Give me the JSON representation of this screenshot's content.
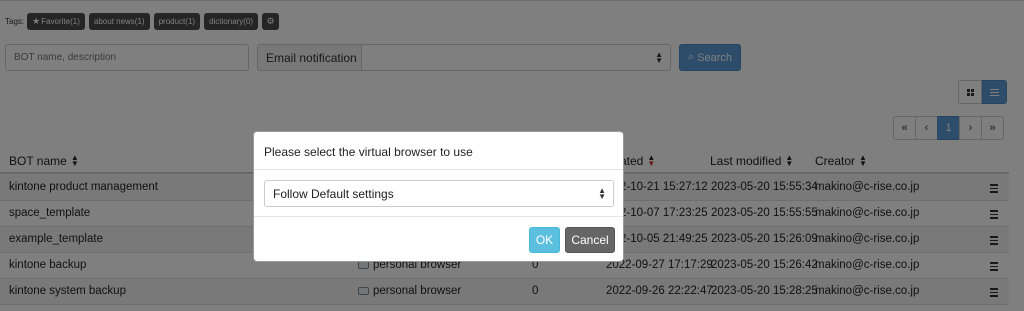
{
  "tags": {
    "label": "Tags:",
    "items": [
      "Favorite(1)",
      "about news(1)",
      "product(1)",
      "dictionary(0)"
    ],
    "settings_icon": "gear-icon"
  },
  "search": {
    "placeholder": "BOT name, description",
    "email_label": "Email notification",
    "email_value": "",
    "button_label": "Search",
    "button_icon": "search-icon"
  },
  "view_toggle": {
    "grid_icon": "grid-icon",
    "list_icon": "list-icon",
    "active": "list"
  },
  "pagination": {
    "first": "«",
    "prev": "‹",
    "current": "1",
    "next": "›",
    "last": "»"
  },
  "table": {
    "headers": {
      "name": "BOT name",
      "created": "ated",
      "modified": "Last modified",
      "creator": "Creator"
    },
    "rows": [
      {
        "name": "kintone product management",
        "browser": "",
        "runs": "",
        "created": "2-10-21 15:27:12",
        "modified": "2023-05-20 15:55:34",
        "creator": "makino@c-rise.co.jp"
      },
      {
        "name": "space_template",
        "browser": "",
        "runs": "",
        "created": "2-10-07 17:23:25",
        "modified": "2023-05-20 15:55:55",
        "creator": "makino@c-rise.co.jp"
      },
      {
        "name": "example_template",
        "browser": "",
        "runs": "",
        "created": "2-10-05 21:49:25",
        "modified": "2023-05-20 15:26:09",
        "creator": "makino@c-rise.co.jp"
      },
      {
        "name": "kintone backup",
        "browser": "personal browser",
        "runs": "0",
        "created": "2022-09-27 17:17:29",
        "modified": "2023-05-20 15:26:42",
        "creator": "makino@c-rise.co.jp"
      },
      {
        "name": "kintone system backup",
        "browser": "personal browser",
        "runs": "0",
        "created": "2022-09-26 22:22:47",
        "modified": "2023-05-20 15:28:25",
        "creator": "makino@c-rise.co.jp"
      }
    ]
  },
  "modal": {
    "title": "Please select the virtual browser to use",
    "selected": "Follow Default settings",
    "ok_label": "OK",
    "cancel_label": "Cancel"
  },
  "colors": {
    "accent": "#5b9bd5",
    "ok": "#5bc0de",
    "cancel": "#666666",
    "overlay": "rgba(0,0,0,0.5)"
  }
}
